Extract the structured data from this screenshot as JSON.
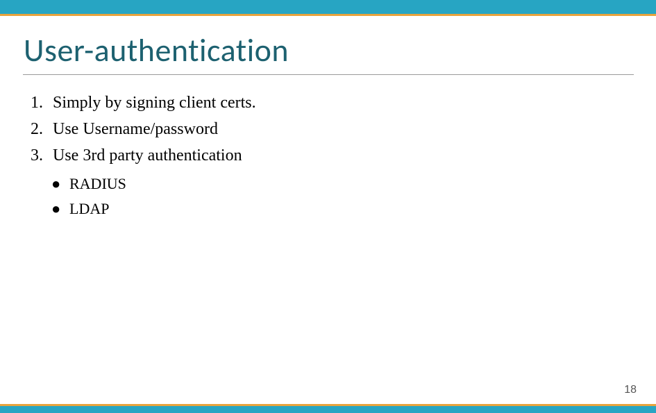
{
  "title": "User-authentication",
  "list": {
    "items": [
      {
        "num": "1.",
        "text": "Simply by signing client certs."
      },
      {
        "num": "2.",
        "text": "Use Username/password"
      },
      {
        "num": "3.",
        "text": "Use 3rd party authentication"
      }
    ],
    "subitems": [
      {
        "bullet": "●",
        "text": "RADIUS"
      },
      {
        "bullet": "●",
        "text": "LDAP"
      }
    ]
  },
  "page_number": "18"
}
